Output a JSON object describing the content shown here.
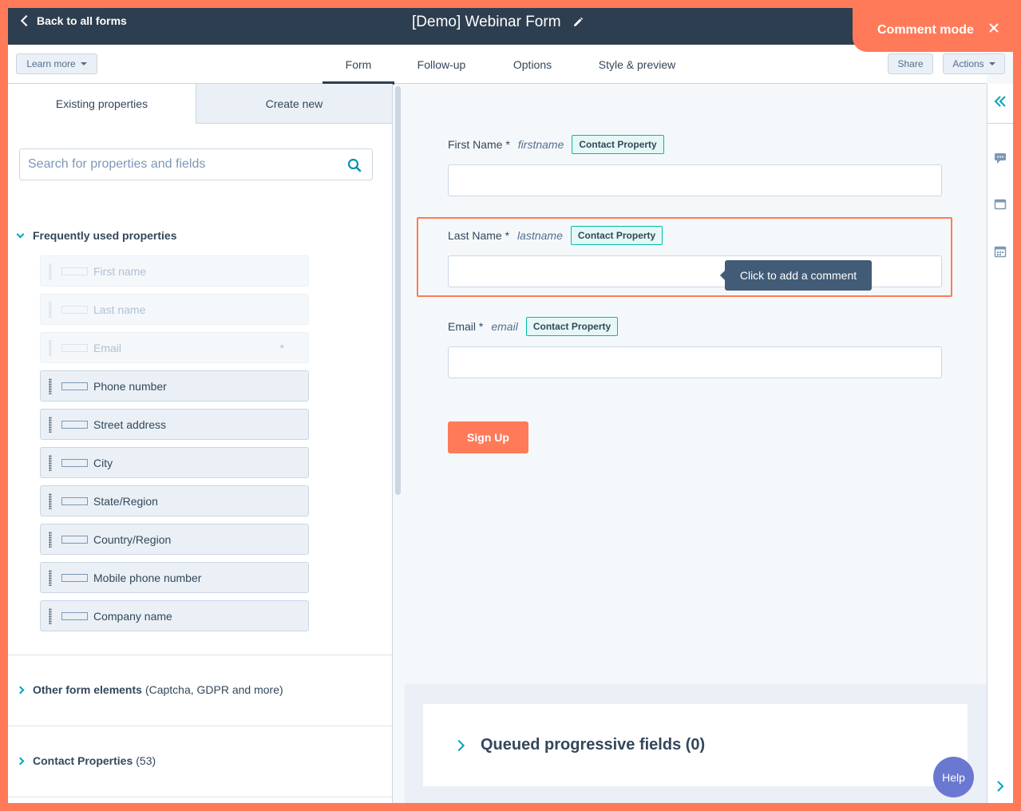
{
  "header": {
    "back_label": "Back to all forms",
    "form_title": "[Demo] Webinar Form",
    "comment_mode_label": "Comment mode"
  },
  "toolbar": {
    "learn_more_label": "Learn more",
    "tabs": [
      {
        "label": "Form",
        "active": true
      },
      {
        "label": "Follow-up",
        "active": false
      },
      {
        "label": "Options",
        "active": false
      },
      {
        "label": "Style & preview",
        "active": false
      }
    ],
    "share_label": "Share",
    "actions_label": "Actions"
  },
  "left_panel": {
    "tabs": [
      {
        "label": "Existing properties",
        "active": true
      },
      {
        "label": "Create new",
        "active": false
      }
    ],
    "search_placeholder": "Search for properties and fields",
    "frequent_section_title": "Frequently used properties",
    "properties": [
      {
        "label": "First name",
        "disabled": true,
        "required": false
      },
      {
        "label": "Last name",
        "disabled": true,
        "required": false
      },
      {
        "label": "Email",
        "disabled": true,
        "required": true
      },
      {
        "label": "Phone number",
        "disabled": false,
        "required": false
      },
      {
        "label": "Street address",
        "disabled": false,
        "required": false
      },
      {
        "label": "City",
        "disabled": false,
        "required": false
      },
      {
        "label": "State/Region",
        "disabled": false,
        "required": false
      },
      {
        "label": "Country/Region",
        "disabled": false,
        "required": false
      },
      {
        "label": "Mobile phone number",
        "disabled": false,
        "required": false
      },
      {
        "label": "Company name",
        "disabled": false,
        "required": false
      }
    ],
    "required_marker": "*",
    "other_section_title": "Other form elements",
    "other_section_note": "(Captcha, GDPR and more)",
    "contact_section_title": "Contact Properties",
    "contact_section_count": "(53)"
  },
  "form_preview": {
    "fields": [
      {
        "label": "First Name *",
        "internal": "firstname",
        "badge": "Contact Property"
      },
      {
        "label": "Last Name *",
        "internal": "lastname",
        "badge": "Contact Property"
      },
      {
        "label": "Email *",
        "internal": "email",
        "badge": "Contact Property"
      }
    ],
    "tooltip": "Click to add a comment",
    "submit_label": "Sign Up",
    "queued_label": "Queued progressive fields (0)"
  },
  "help_label": "Help",
  "colors": {
    "accent": "#ff7a59",
    "navy": "#2d3e50",
    "teal": "#00a4bd",
    "help": "#6a78d1"
  }
}
